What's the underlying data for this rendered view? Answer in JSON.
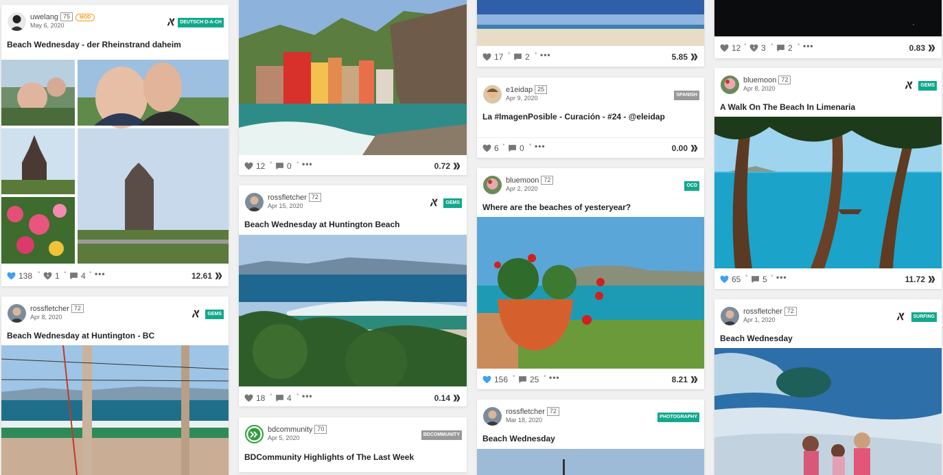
{
  "col1": {
    "c1": {
      "author": "uwelang",
      "rep": "75",
      "badge": "MOD",
      "date": "May 6, 2020",
      "tag": "DEUTSCH D-A-CH",
      "title": "Beach Wednesday - der Rheinstrand daheim",
      "likes": "138",
      "flags": "1",
      "comments": "4",
      "payout": "12.61"
    },
    "c2": {
      "author": "rossfletcher",
      "rep": "72",
      "date": "Apr 8, 2020",
      "tag": "GEMS",
      "title": "Beach Wednesday at Huntington - BC"
    }
  },
  "col2": {
    "c1": {
      "likes": "12",
      "comments": "0",
      "payout": "0.72"
    },
    "c2": {
      "author": "rossfletcher",
      "rep": "72",
      "date": "Apr 15, 2020",
      "tag": "GEMS",
      "title": "Beach Wednesday at Huntington Beach",
      "likes": "18",
      "comments": "4",
      "payout": "0.14"
    },
    "c3": {
      "author": "bdcommunity",
      "rep": "70",
      "date": "Apr 5, 2020",
      "tag": "BDCOMMUNITY",
      "title": "BDCommunity Highlights of The Last Week"
    }
  },
  "col3": {
    "c1": {
      "likes": "17",
      "comments": "2",
      "payout": "5.85"
    },
    "c2": {
      "author": "e1eidap",
      "rep": "25",
      "date": "Apr 9, 2020",
      "tag": "SPANISH",
      "title": "La #ImagenPosible - Curación - #24 - @eleidap",
      "likes": "6",
      "comments": "0",
      "payout": "0.00"
    },
    "c3": {
      "author": "bluemoon",
      "rep": "72",
      "date": "Apr 2, 2020",
      "tag": "OCD",
      "title": "Where are the beaches of yesteryear?",
      "likes": "156",
      "comments": "25",
      "payout": "8.21"
    },
    "c4": {
      "author": "rossfletcher",
      "rep": "72",
      "date": "Mar 18, 2020",
      "tag": "PHOTOGRAPHY",
      "title": "Beach Wednesday"
    }
  },
  "col4": {
    "c1": {
      "likes": "12",
      "flags": "3",
      "comments": "2",
      "payout": "0.83"
    },
    "c2": {
      "author": "bluemoon",
      "rep": "72",
      "date": "Apr 8, 2020",
      "tag": "GEMS",
      "title": "A Walk On The Beach In Limenaria",
      "likes": "65",
      "comments": "5",
      "payout": "11.72"
    },
    "c3": {
      "author": "rossfletcher",
      "rep": "72",
      "date": "Apr 1, 2020",
      "tag": "SURFING",
      "title": "Beach Wednesday"
    }
  },
  "colors": {
    "teal": "#12a88c",
    "gray": "#999999",
    "liked": "#3ea1f5",
    "mod": "#f39c12"
  },
  "icons": [
    "heart-icon",
    "flag-icon",
    "comment-icon",
    "more-icon",
    "hive-icon",
    "community-icon"
  ]
}
